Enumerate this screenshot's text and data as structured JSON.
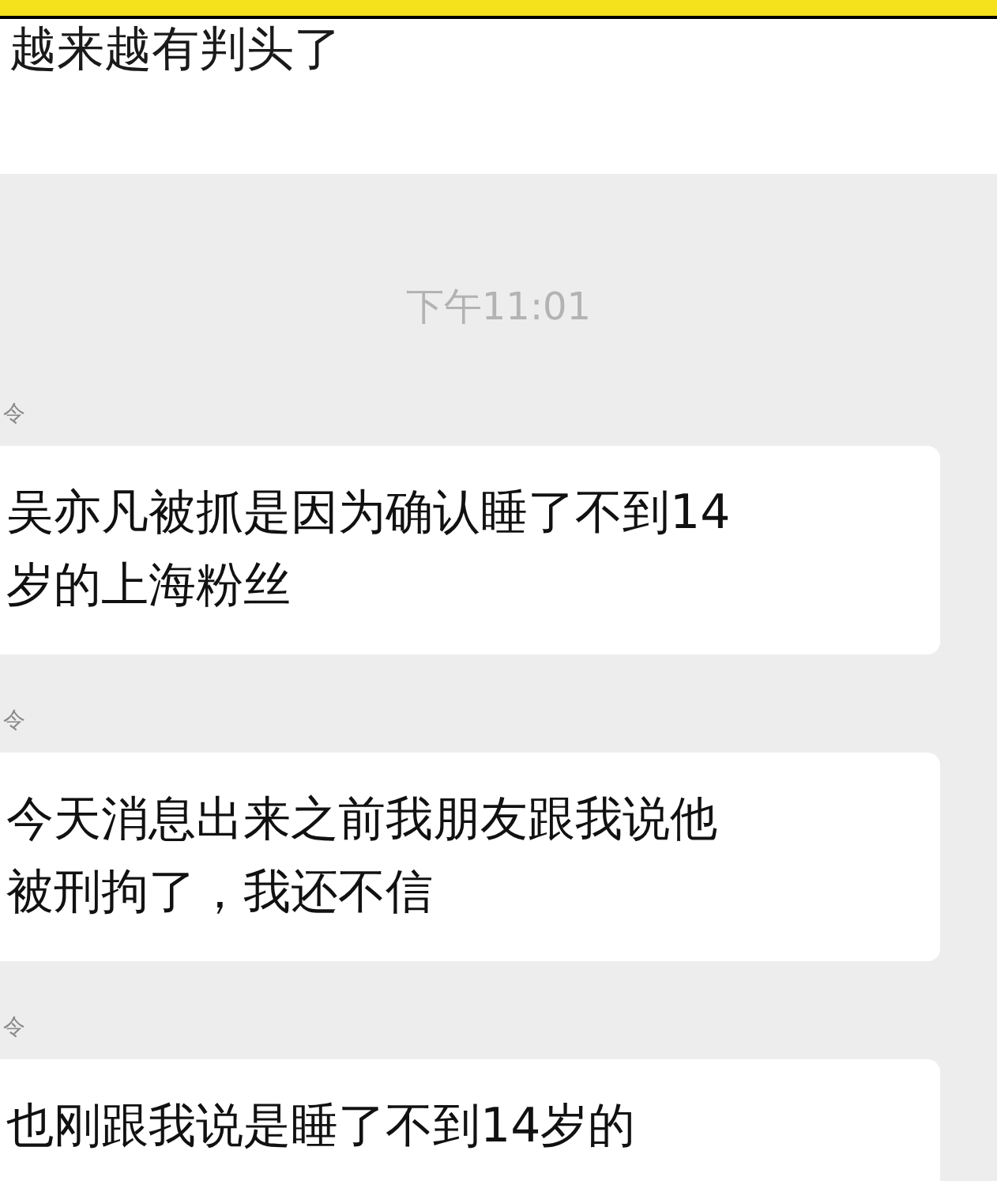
{
  "header": {
    "text": "越来越有判头了"
  },
  "chat": {
    "timestamp": "下午11:01",
    "messages": [
      {
        "sender": "令",
        "lines": [
          "吴亦凡被抓是因为确认睡了不到14",
          "岁的上海粉丝"
        ]
      },
      {
        "sender": "令",
        "lines": [
          "今天消息出来之前我朋友跟我说他",
          "被刑拘了，我还不信"
        ]
      },
      {
        "sender": "令",
        "lines": [
          "也刚跟我说是睡了不到14岁的"
        ]
      }
    ]
  }
}
